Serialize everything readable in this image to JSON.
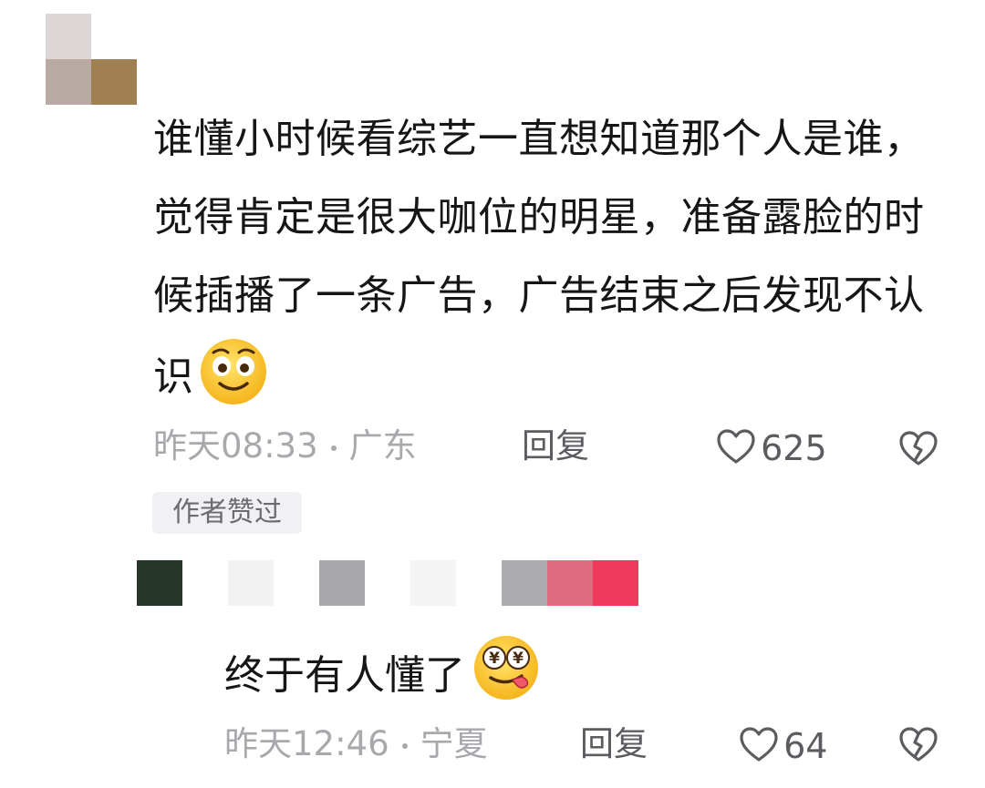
{
  "comment": {
    "text": "谁懂小时候看综艺一直想知道那个人是谁，觉得肯定是很大咖位的明星，准备露脸的时候插播了一条广告，广告结束之后发现不认识",
    "emoji_name": "smiling-face-emoji",
    "time": "昨天08:33",
    "location": "广东",
    "reply_label": "回复",
    "likes": "625",
    "author_liked_badge": "作者赞过"
  },
  "reply_comment": {
    "text": "终于有人懂了",
    "emoji_name": "money-eyes-tongue-emoji",
    "time": "昨天12:46",
    "location": "宁夏",
    "reply_label": "回复",
    "likes": "64"
  },
  "colors": {
    "text_primary": "#161616",
    "text_meta": "#a8a8ad",
    "text_action": "#5b5b60"
  }
}
